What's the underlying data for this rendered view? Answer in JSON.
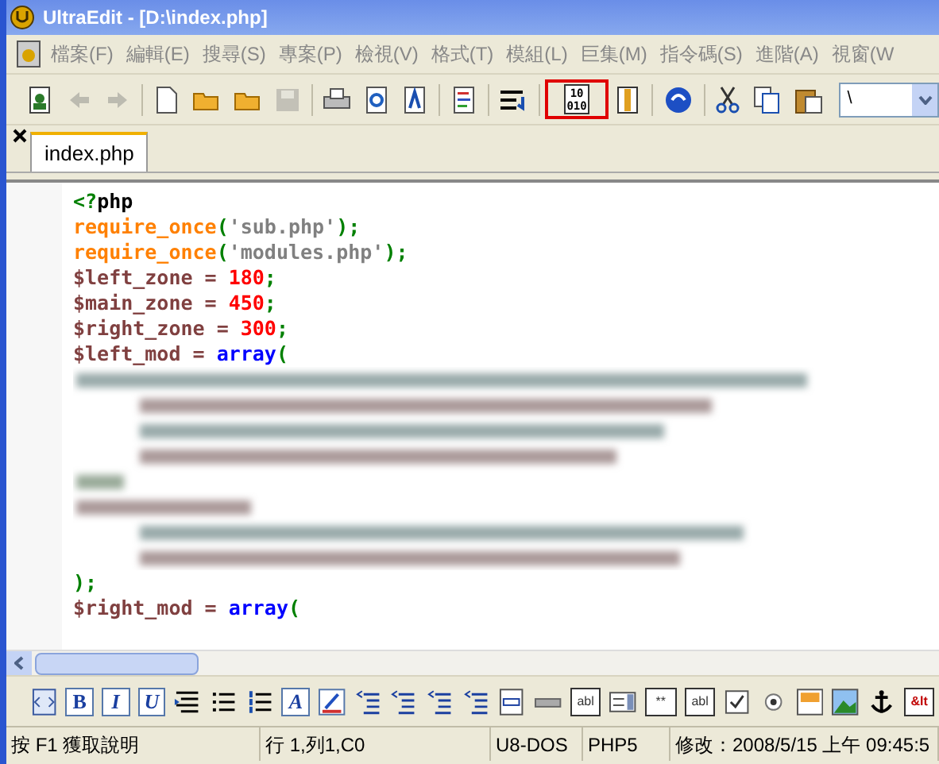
{
  "window": {
    "title": "UltraEdit - [D:\\index.php]"
  },
  "menu": [
    {
      "label": "檔案(F)"
    },
    {
      "label": "編輯(E)"
    },
    {
      "label": "搜尋(S)"
    },
    {
      "label": "專案(P)"
    },
    {
      "label": "檢視(V)"
    },
    {
      "label": "格式(T)"
    },
    {
      "label": "模組(L)"
    },
    {
      "label": "巨集(M)"
    },
    {
      "label": "指令碼(S)"
    },
    {
      "label": "進階(A)"
    },
    {
      "label": "視窗(W"
    }
  ],
  "toolbar": [
    {
      "kind": "person-doc",
      "disabled": false
    },
    {
      "kind": "arrow-left",
      "disabled": true
    },
    {
      "kind": "arrow-right",
      "disabled": true
    },
    {
      "kind": "sep"
    },
    {
      "kind": "new-doc",
      "disabled": false
    },
    {
      "kind": "folder",
      "disabled": false
    },
    {
      "kind": "folder",
      "disabled": false
    },
    {
      "kind": "save",
      "disabled": true
    },
    {
      "kind": "sep"
    },
    {
      "kind": "printer",
      "disabled": false
    },
    {
      "kind": "preview",
      "disabled": false
    },
    {
      "kind": "text-doc",
      "disabled": false
    },
    {
      "kind": "sep"
    },
    {
      "kind": "lines-doc",
      "disabled": false
    },
    {
      "kind": "sep"
    },
    {
      "kind": "wrap",
      "disabled": false
    },
    {
      "kind": "sep"
    },
    {
      "kind": "hex",
      "label": "10 010",
      "disabled": false,
      "highlighted": true
    },
    {
      "kind": "column-doc",
      "disabled": false
    },
    {
      "kind": "sep"
    },
    {
      "kind": "globe",
      "disabled": false
    },
    {
      "kind": "sep"
    },
    {
      "kind": "scissors",
      "disabled": false
    },
    {
      "kind": "copy",
      "disabled": false
    },
    {
      "kind": "paste",
      "disabled": false
    }
  ],
  "search_combo": {
    "value": "\\"
  },
  "tabs": [
    {
      "label": "index.php",
      "selected": true
    }
  ],
  "code": [
    [
      {
        "text": "<?",
        "kind": "tag"
      },
      {
        "text": "php",
        "kind": "plain"
      }
    ],
    [
      {
        "text": "require_once",
        "kind": "func"
      },
      {
        "text": "(",
        "kind": "punct"
      },
      {
        "text": "'sub.php'",
        "kind": "string"
      },
      {
        "text": ");",
        "kind": "punct"
      }
    ],
    [
      {
        "text": "require_once",
        "kind": "func"
      },
      {
        "text": "(",
        "kind": "punct"
      },
      {
        "text": "'modules.php'",
        "kind": "string"
      },
      {
        "text": ");",
        "kind": "punct"
      }
    ],
    [
      {
        "text": "$left_zone",
        "kind": "var"
      },
      {
        "text": " = ",
        "kind": "op"
      },
      {
        "text": "180",
        "kind": "num"
      },
      {
        "text": ";",
        "kind": "punct"
      }
    ],
    [
      {
        "text": "$main_zone",
        "kind": "var"
      },
      {
        "text": " = ",
        "kind": "op"
      },
      {
        "text": "450",
        "kind": "num"
      },
      {
        "text": ";",
        "kind": "punct"
      }
    ],
    [
      {
        "text": "$right_zone",
        "kind": "var"
      },
      {
        "text": " = ",
        "kind": "op"
      },
      {
        "text": "300",
        "kind": "num"
      },
      {
        "text": ";",
        "kind": "punct"
      }
    ],
    [
      {
        "text": "$left_mod",
        "kind": "var"
      },
      {
        "text": " = ",
        "kind": "op"
      },
      {
        "text": "array",
        "kind": "kw"
      },
      {
        "text": "(",
        "kind": "punct"
      }
    ],
    {
      "kind": "blurred"
    },
    [
      {
        "text": ");",
        "kind": "punct"
      }
    ],
    [
      {
        "text": "$right_mod",
        "kind": "var"
      },
      {
        "text": " = ",
        "kind": "op"
      },
      {
        "text": "array",
        "kind": "kw"
      },
      {
        "text": "(",
        "kind": "punct"
      }
    ]
  ],
  "format_toolbar": [
    {
      "kind": "html-doc"
    },
    {
      "kind": "letter",
      "label": "B"
    },
    {
      "kind": "letter",
      "label": "I"
    },
    {
      "kind": "letter",
      "label": "U"
    },
    {
      "kind": "align"
    },
    {
      "kind": "bullets"
    },
    {
      "kind": "numbers"
    },
    {
      "kind": "letter",
      "label": "A"
    },
    {
      "kind": "pen"
    },
    {
      "kind": "indent"
    },
    {
      "kind": "indent"
    },
    {
      "kind": "indent"
    },
    {
      "kind": "indent"
    },
    {
      "kind": "form"
    },
    {
      "kind": "hr"
    },
    {
      "kind": "field",
      "label": "abl"
    },
    {
      "kind": "listbox"
    },
    {
      "kind": "field",
      "label": "**"
    },
    {
      "kind": "field",
      "label": "abl"
    },
    {
      "kind": "checkbox"
    },
    {
      "kind": "radio"
    },
    {
      "kind": "frame"
    },
    {
      "kind": "image"
    },
    {
      "kind": "anchor"
    },
    {
      "kind": "entity",
      "label": "&lt"
    }
  ],
  "status_bar": [
    "按 F1 獲取說明",
    "行 1,列1,C0",
    "U8-DOS",
    "PHP5",
    "修改：2008/5/15 上午 09:45:5"
  ]
}
